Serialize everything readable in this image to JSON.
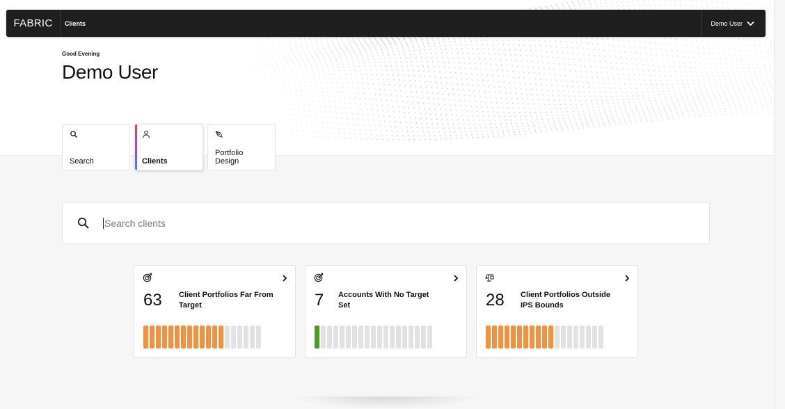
{
  "topbar": {
    "brand": "FABRIC",
    "breadcrumb": "Clients",
    "user_menu_label": "Demo User"
  },
  "header": {
    "greeting": "Good Evening",
    "username": "Demo User"
  },
  "nav_tiles": [
    {
      "label": "Search",
      "icon": "search-icon",
      "active": false
    },
    {
      "label": "Clients",
      "icon": "user-icon",
      "active": true
    },
    {
      "label": "Portfolio Design",
      "icon": "pen-tool-icon",
      "active": false
    }
  ],
  "search": {
    "placeholder": "Search clients",
    "value": ""
  },
  "cards": [
    {
      "count": "63",
      "title": "Client Portfolios Far From Target",
      "icon": "target-icon",
      "bars_filled": 13,
      "bars_total": 19,
      "fill_color": "#f0923f"
    },
    {
      "count": "7",
      "title": "Accounts With No Target Set",
      "icon": "target-icon",
      "bars_filled": 1,
      "bars_total": 19,
      "fill_color": "#4e9a2f"
    },
    {
      "count": "28",
      "title": "Client Portfolios Outside IPS Bounds",
      "icon": "scale-icon",
      "bars_filled": 11,
      "bars_total": 19,
      "fill_color": "#f0923f"
    }
  ],
  "colors": {
    "topbar_bg": "#1f1f1f",
    "bar_empty": "#e2e2e2",
    "active_tile_accent_start": "#c94f4f",
    "active_tile_accent_end": "#4f7be0"
  }
}
